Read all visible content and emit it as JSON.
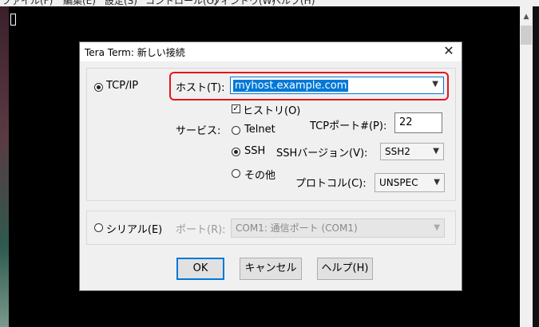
{
  "menubar": {
    "items": [
      "ファイル(F)",
      "編集(E)",
      "設定(S)",
      "コントロール(O)",
      "ウィンドウ(W)",
      "ヘルプ(H)"
    ]
  },
  "dialog": {
    "title": "Tera Term: 新しい接続",
    "close_glyph": "✕",
    "tcpip": {
      "radio_label": "TCP/IP",
      "selected": true,
      "host_label": "ホスト(T):",
      "host_value": "myhost.example.com",
      "history_label": "ヒストリ(O)",
      "history_checked": true,
      "service_label": "サービス:",
      "services": [
        {
          "label": "Telnet",
          "selected": false
        },
        {
          "label": "SSH",
          "selected": true
        },
        {
          "label": "その他",
          "selected": false
        }
      ],
      "tcp_port_label": "TCPポート#(P):",
      "tcp_port_value": "22",
      "ssh_version_label": "SSHバージョン(V):",
      "ssh_version_value": "SSH2",
      "protocol_label": "プロトコル(C):",
      "protocol_value": "UNSPEC"
    },
    "serial": {
      "radio_label": "シリアル(E)",
      "selected": false,
      "port_label": "ポート(R):",
      "port_value": "COM1: 通信ポート (COM1)"
    },
    "buttons": {
      "ok": "OK",
      "cancel": "キャンセル",
      "help": "ヘルプ(H)"
    }
  },
  "icons": {
    "dropdown": "chevron-down-icon",
    "close": "close-icon"
  },
  "colors": {
    "accent": "#0078d7",
    "highlight_box": "#e5141b",
    "terminal_bg": "#000000"
  }
}
